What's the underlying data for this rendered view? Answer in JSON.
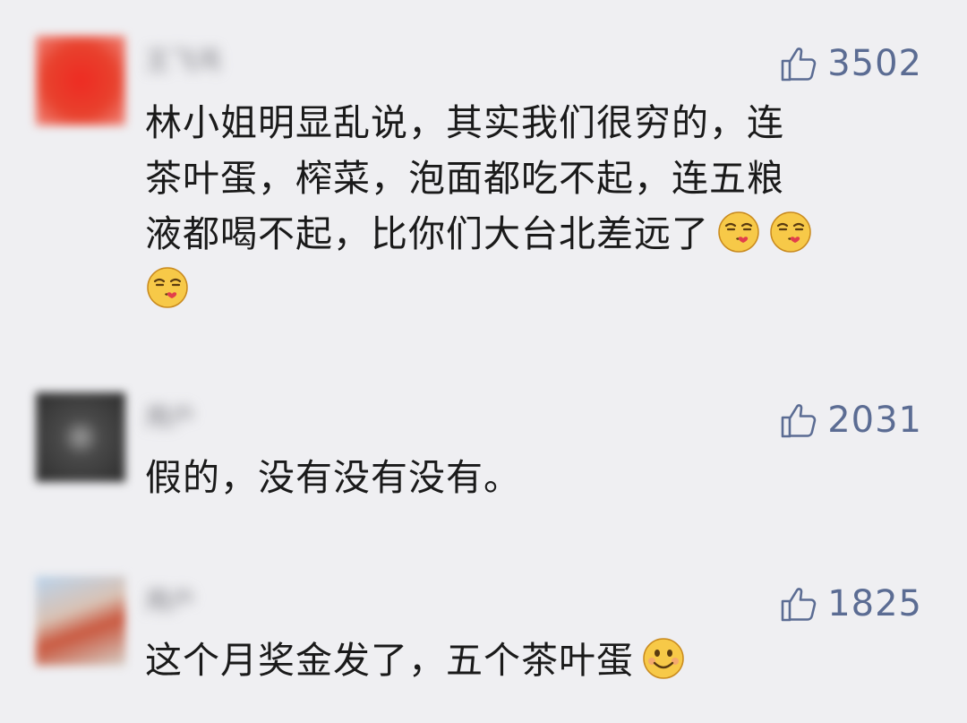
{
  "comments": [
    {
      "username": "王飞鸿",
      "likes": "3502",
      "text_lines": [
        "林小姐明显乱说，其实我们很穷的，连",
        "茶叶蛋，榨菜，泡面都吃不起，连五粮",
        "液都喝不起，比你们大台北差远了"
      ],
      "emojis": [
        "kissing-face-emoji",
        "kissing-face-emoji",
        "kissing-face-emoji"
      ]
    },
    {
      "username": "用户",
      "likes": "2031",
      "text_lines": [
        "假的，没有没有没有。"
      ]
    },
    {
      "username": "用户",
      "likes": "1825",
      "text_lines": [
        "这个月奖金发了，五个茶叶蛋"
      ],
      "emojis": [
        "smiling-face-emoji"
      ]
    }
  ],
  "colors": {
    "background": "#efeff2",
    "like_accent": "#5b6c93",
    "text": "#1a1a1a"
  },
  "icons": {
    "like": "thumbs-up-icon"
  }
}
